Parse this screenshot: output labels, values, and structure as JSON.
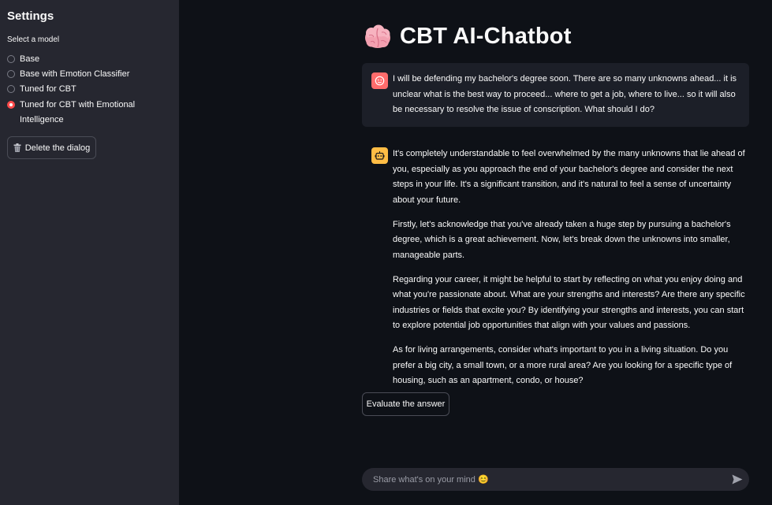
{
  "sidebar": {
    "title": "Settings",
    "select_label": "Select a model",
    "models": [
      {
        "label": "Base",
        "selected": false
      },
      {
        "label": "Base with Emotion Classifier",
        "selected": false
      },
      {
        "label": "Tuned for CBT",
        "selected": false
      },
      {
        "label": "Tuned for CBT with Emotional Intelligence",
        "selected": true
      }
    ],
    "delete_button": "Delete the dialog"
  },
  "main": {
    "title": "CBT AI-Chatbot",
    "title_icon": "brain-icon",
    "user_message": "I will be defending my bachelor's degree soon. There are so many unknowns ahead... it is unclear what is the best way to proceed... where to get a job, where to live... so it will also be necessary to resolve the issue of conscription. What should I do?",
    "assistant_paragraphs": [
      "It's completely understandable to feel overwhelmed by the many unknowns that lie ahead of you, especially as you approach the end of your bachelor's degree and consider the next steps in your life. It's a significant transition, and it's natural to feel a sense of uncertainty about your future.",
      "Firstly, let's acknowledge that you've already taken a huge step by pursuing a bachelor's degree, which is a great achievement. Now, let's break down the unknowns into smaller, manageable parts.",
      "Regarding your career, it might be helpful to start by reflecting on what you enjoy doing and what you're passionate about. What are your strengths and interests? Are there any specific industries or fields that excite you? By identifying your strengths and interests, you can start to explore potential job opportunities that align with your values and passions.",
      "As for living arrangements, consider what's important to you in a living situation. Do you prefer a big city, a small town, or a more rural area? Are you looking for a specific type of housing, such as an apartment, condo, or house?"
    ],
    "evaluate_button": "Evaluate the answer",
    "chat_input_placeholder": "Share what's on your mind 😊"
  },
  "colors": {
    "accent": "#ff4b4b",
    "user_avatar": "#ff6c6c",
    "bot_avatar": "#ffbd45",
    "background": "#0e1117",
    "sidebar": "#262730"
  }
}
